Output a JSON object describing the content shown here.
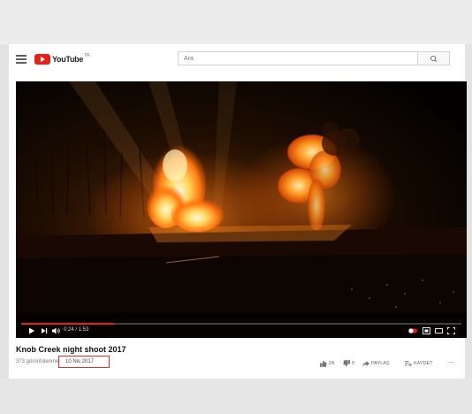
{
  "masthead": {
    "logo_text": "YouTube",
    "logo_country": "TR",
    "search_placeholder": "Ara"
  },
  "player": {
    "time_display": "0:24 / 1:53",
    "progress_fraction": 0.21
  },
  "video": {
    "title": "Knob Creek night shoot 2017",
    "views": "373 görüntülenme",
    "date": "10 Nis 2017"
  },
  "actions": {
    "likes": "24",
    "dislikes": "0",
    "share_label": "PAYLAŞ",
    "save_label": "KAYDET",
    "more_label": "..."
  },
  "colors": {
    "youtube_red": "#e62117",
    "highlight_box": "#e03127",
    "page_bg": "#ffffff",
    "outer_bg": "#e3e3e3"
  },
  "icons": [
    "menu-icon",
    "youtube-logo-icon",
    "search-icon",
    "play-icon",
    "next-icon",
    "volume-icon",
    "autoplay-toggle-icon",
    "subtitles-icon",
    "miniplayer-icon",
    "theater-icon",
    "fullscreen-icon",
    "thumbs-up-icon",
    "thumbs-down-icon",
    "share-icon",
    "add-to-playlist-icon",
    "more-icon"
  ]
}
